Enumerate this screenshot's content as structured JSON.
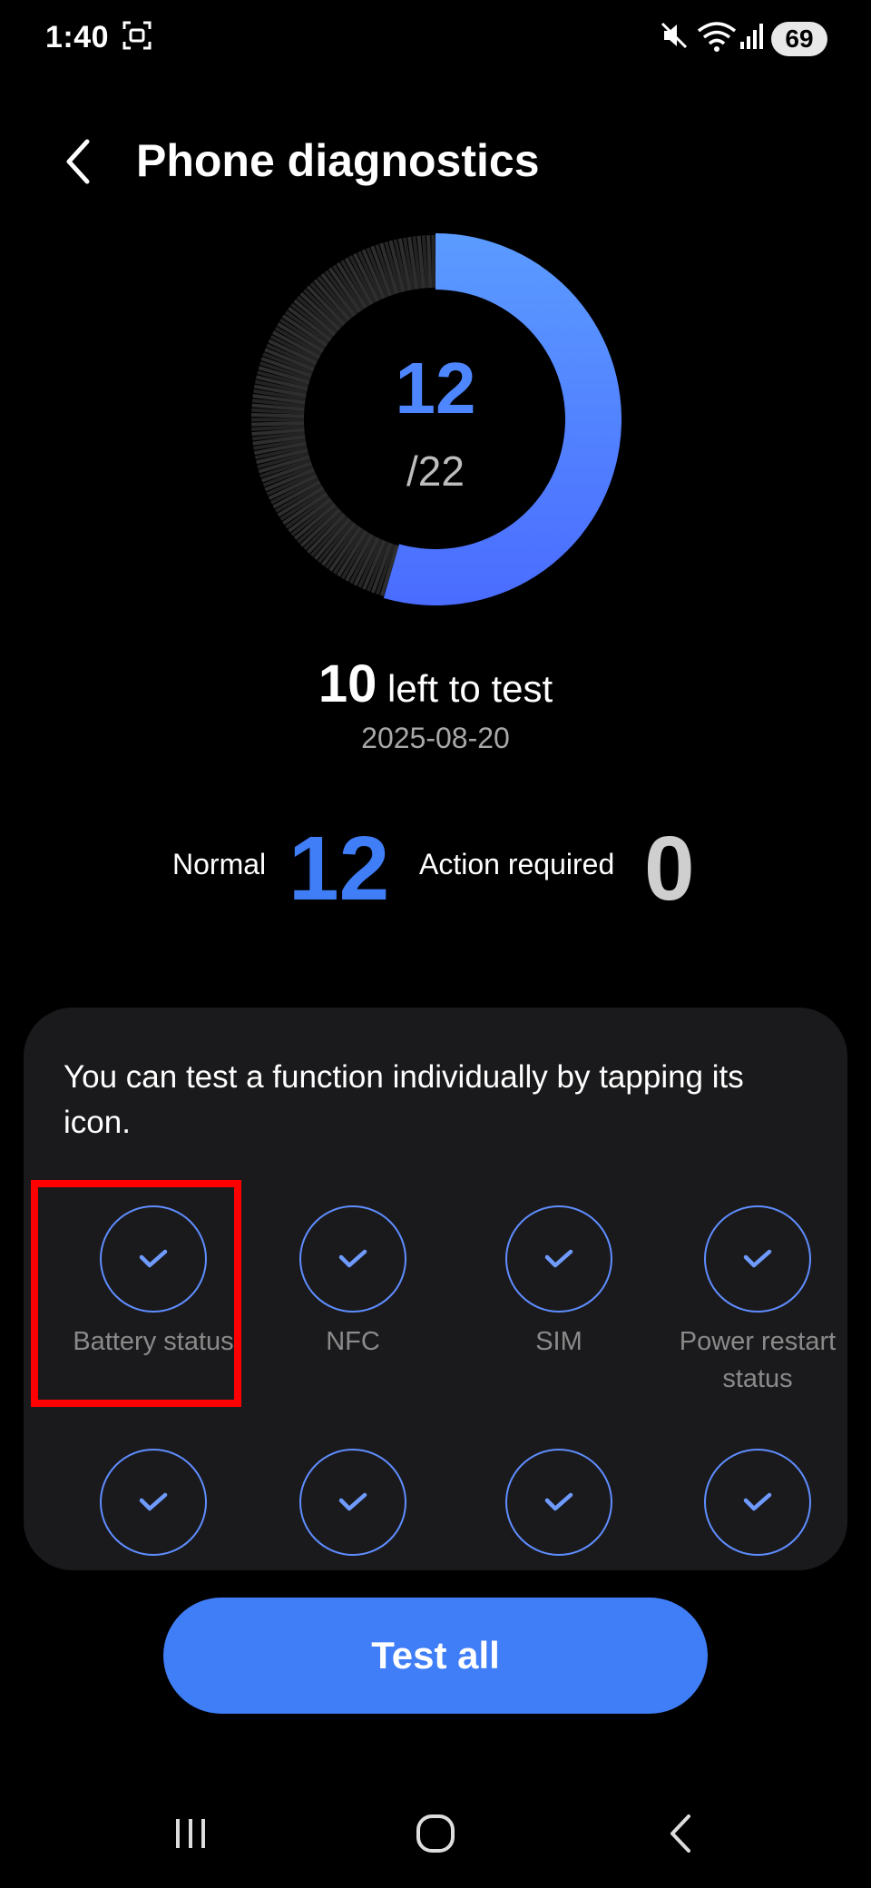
{
  "status_bar": {
    "time": "1:40",
    "battery": "69"
  },
  "header": {
    "title": "Phone diagnostics"
  },
  "progress": {
    "completed": "12",
    "total": "/22",
    "fraction": 0.545
  },
  "remaining": {
    "count": "10",
    "label": "left to test"
  },
  "date": "2025-08-20",
  "summary": {
    "normal_label": "Normal",
    "normal_count": "12",
    "action_label": "Action required",
    "action_count": "0"
  },
  "panel": {
    "description": "You can test a function individually by tapping its icon.",
    "row1": [
      "Battery status",
      "NFC",
      "SIM",
      "Power restart status"
    ]
  },
  "test_all_label": "Test all",
  "colors": {
    "accent": "#3f7ef7",
    "ring_start": "#5b9bff",
    "ring_end": "#4a6cff",
    "highlight": "#ff0000"
  }
}
